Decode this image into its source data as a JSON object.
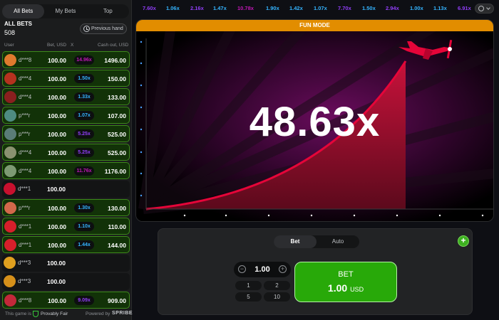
{
  "left_panel": {
    "tabs": [
      "All Bets",
      "My Bets",
      "Top"
    ],
    "title": "ALL BETS",
    "count": "508",
    "previous_hand": "Previous hand",
    "columns": {
      "user": "User",
      "bet": "Bet, USD",
      "x": "X",
      "cashout": "Cash out, USD"
    },
    "rows": [
      {
        "user": "d***8",
        "bet": "100.00",
        "mult": "14.96x",
        "mult_color": "#c017b4",
        "cash": "1496.00",
        "win": true,
        "avatar": "#e07a2e"
      },
      {
        "user": "d***4",
        "bet": "100.00",
        "mult": "1.50x",
        "mult_color": "#34b4ff",
        "cash": "150.00",
        "win": true,
        "avatar": "#b5321f"
      },
      {
        "user": "d***4",
        "bet": "100.00",
        "mult": "1.33x",
        "mult_color": "#34b4ff",
        "cash": "133.00",
        "win": true,
        "avatar": "#8a1f1f"
      },
      {
        "user": "p***r",
        "bet": "100.00",
        "mult": "1.07x",
        "mult_color": "#34b4ff",
        "cash": "107.00",
        "win": true,
        "avatar": "#4e8b82"
      },
      {
        "user": "p***r",
        "bet": "100.00",
        "mult": "5.25x",
        "mult_color": "#913ef8",
        "cash": "525.00",
        "win": true,
        "avatar": "#5a7c77"
      },
      {
        "user": "d***4",
        "bet": "100.00",
        "mult": "5.25x",
        "mult_color": "#913ef8",
        "cash": "525.00",
        "win": true,
        "avatar": "#8a9270"
      },
      {
        "user": "d***4",
        "bet": "100.00",
        "mult": "11.76x",
        "mult_color": "#c017b4",
        "cash": "1176.00",
        "win": true,
        "avatar": "#7d9a73"
      },
      {
        "user": "d***1",
        "bet": "100.00",
        "mult": "",
        "mult_color": "",
        "cash": "",
        "win": false,
        "avatar": "#c8102e"
      },
      {
        "user": "p***r",
        "bet": "100.00",
        "mult": "1.30x",
        "mult_color": "#34b4ff",
        "cash": "130.00",
        "win": true,
        "avatar": "#d2684b"
      },
      {
        "user": "d***1",
        "bet": "100.00",
        "mult": "1.10x",
        "mult_color": "#34b4ff",
        "cash": "110.00",
        "win": true,
        "avatar": "#d61f2b"
      },
      {
        "user": "d***1",
        "bet": "100.00",
        "mult": "1.44x",
        "mult_color": "#34b4ff",
        "cash": "144.00",
        "win": true,
        "avatar": "#d61f2b"
      },
      {
        "user": "d***3",
        "bet": "100.00",
        "mult": "",
        "mult_color": "",
        "cash": "",
        "win": false,
        "avatar": "#e0a01f"
      },
      {
        "user": "d***3",
        "bet": "100.00",
        "mult": "",
        "mult_color": "",
        "cash": "",
        "win": false,
        "avatar": "#d6901a"
      },
      {
        "user": "d***8",
        "bet": "100.00",
        "mult": "9.09x",
        "mult_color": "#913ef8",
        "cash": "909.00",
        "win": true,
        "avatar": "#c3283a"
      }
    ],
    "footer": {
      "fair_text": "This game is",
      "fair_label": "Provably Fair",
      "powered": "Powered by",
      "brand": "SPRIBE"
    }
  },
  "history": [
    {
      "value": "7.60x",
      "color": "#913ef8"
    },
    {
      "value": "1.06x",
      "color": "#34b4ff"
    },
    {
      "value": "2.16x",
      "color": "#913ef8"
    },
    {
      "value": "1.47x",
      "color": "#34b4ff"
    },
    {
      "value": "10.78x",
      "color": "#c017b4"
    },
    {
      "value": "1.90x",
      "color": "#34b4ff"
    },
    {
      "value": "1.42x",
      "color": "#34b4ff"
    },
    {
      "value": "1.07x",
      "color": "#34b4ff"
    },
    {
      "value": "7.70x",
      "color": "#913ef8"
    },
    {
      "value": "1.50x",
      "color": "#34b4ff"
    },
    {
      "value": "2.94x",
      "color": "#913ef8"
    },
    {
      "value": "1.00x",
      "color": "#34b4ff"
    },
    {
      "value": "1.13x",
      "color": "#34b4ff"
    },
    {
      "value": "6.91x",
      "color": "#913ef8"
    }
  ],
  "game": {
    "mode_label": "FUN MODE",
    "multiplier": "48.63x",
    "accent_color": "#e50539",
    "plane_icon": "plane-icon"
  },
  "bet_panel": {
    "tabs": [
      "Bet",
      "Auto"
    ],
    "amount": "1.00",
    "quick_amounts": [
      "1",
      "2",
      "5",
      "10"
    ],
    "bet_label": "BET",
    "bet_amount": "1.00",
    "currency": "USD"
  }
}
